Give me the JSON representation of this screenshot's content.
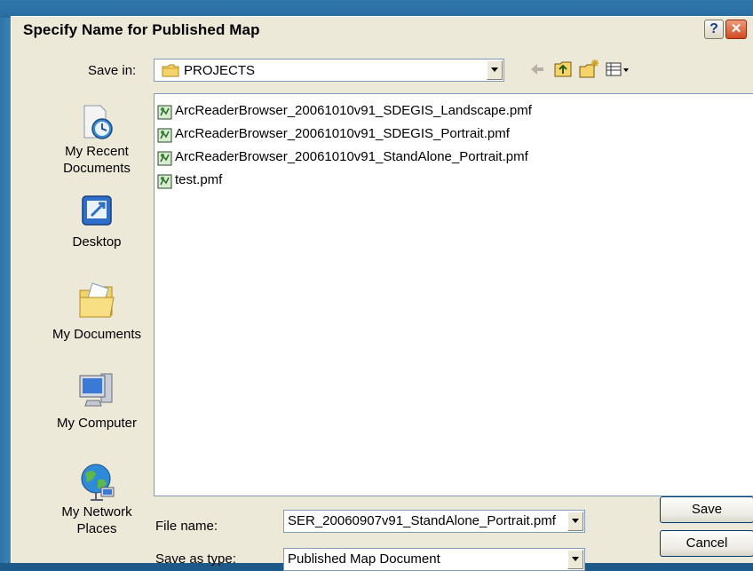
{
  "dialog": {
    "title": "Specify Name for Published Map",
    "help_glyph": "?",
    "close_glyph": "✕"
  },
  "save_in": {
    "label": "Save in:",
    "value": "PROJECTS"
  },
  "toolbar": {
    "icons": [
      "back-arrow-icon",
      "up-one-level-icon",
      "create-new-folder-icon",
      "view-menu-icon"
    ]
  },
  "places": [
    {
      "label_line1": "My Recent",
      "label_line2": "Documents",
      "icon": "my-recent-documents-icon"
    },
    {
      "label_line1": "Desktop",
      "label_line2": "",
      "icon": "desktop-icon"
    },
    {
      "label_line1": "My Documents",
      "label_line2": "",
      "icon": "my-documents-icon"
    },
    {
      "label_line1": "My Computer",
      "label_line2": "",
      "icon": "my-computer-icon"
    },
    {
      "label_line1": "My Network",
      "label_line2": "Places",
      "icon": "my-network-places-icon"
    }
  ],
  "files": [
    {
      "name": "ArcReaderBrowser_20061010v91_SDEGIS_Landscape.pmf"
    },
    {
      "name": "ArcReaderBrowser_20061010v91_SDEGIS_Portrait.pmf"
    },
    {
      "name": "ArcReaderBrowser_20061010v91_StandAlone_Portrait.pmf"
    },
    {
      "name": "test.pmf"
    }
  ],
  "file_name": {
    "label": "File name:",
    "value": "SER_20060907v91_StandAlone_Portrait.pmf"
  },
  "save_as_type": {
    "label": "Save as type:",
    "value": "Published Map Document"
  },
  "buttons": {
    "save": "Save",
    "cancel": "Cancel"
  }
}
